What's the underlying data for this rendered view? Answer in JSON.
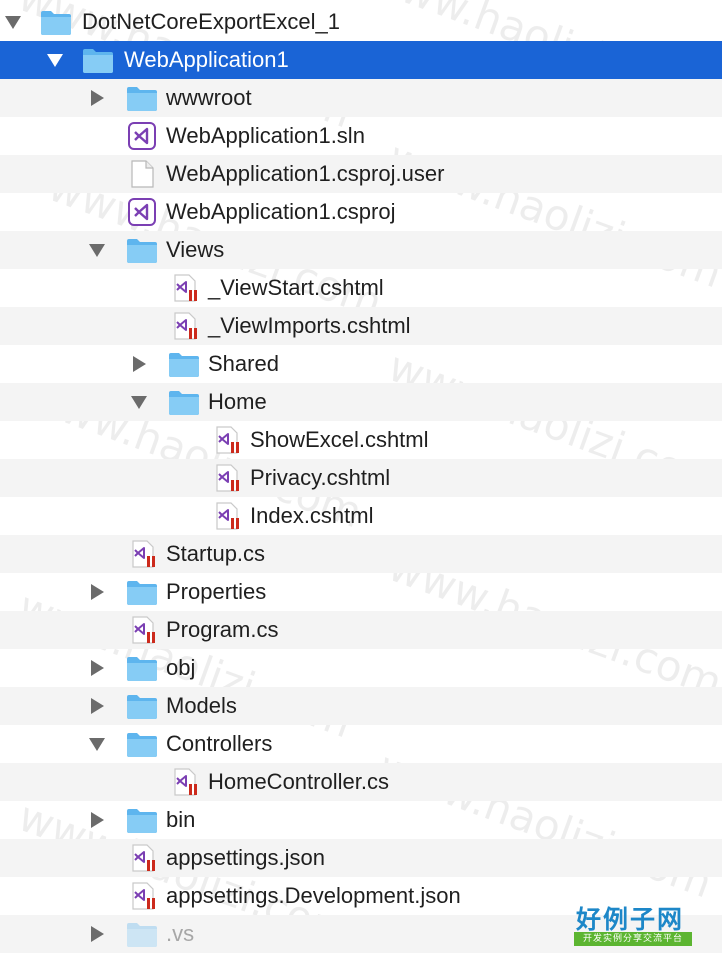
{
  "tree": {
    "rows": [
      {
        "label": "DotNetCoreExportExcel_1",
        "icon": "folder-icon",
        "disclosure": "expanded"
      },
      {
        "label": "WebApplication1",
        "icon": "folder-icon",
        "disclosure": "expanded",
        "selected": true
      },
      {
        "label": "wwwroot",
        "icon": "folder-icon",
        "disclosure": "collapsed"
      },
      {
        "label": "WebApplication1.sln",
        "icon": "visual-studio-icon",
        "disclosure": "none"
      },
      {
        "label": "WebApplication1.csproj.user",
        "icon": "blank-file-icon",
        "disclosure": "none"
      },
      {
        "label": "WebApplication1.csproj",
        "icon": "visual-studio-icon",
        "disclosure": "none"
      },
      {
        "label": "Views",
        "icon": "folder-icon",
        "disclosure": "expanded"
      },
      {
        "label": "_ViewStart.cshtml",
        "icon": "visual-studio-source-file-icon",
        "disclosure": "none"
      },
      {
        "label": "_ViewImports.cshtml",
        "icon": "visual-studio-source-file-icon",
        "disclosure": "none"
      },
      {
        "label": "Shared",
        "icon": "folder-icon",
        "disclosure": "collapsed"
      },
      {
        "label": "Home",
        "icon": "folder-icon",
        "disclosure": "expanded"
      },
      {
        "label": "ShowExcel.cshtml",
        "icon": "visual-studio-source-file-icon",
        "disclosure": "none"
      },
      {
        "label": "Privacy.cshtml",
        "icon": "visual-studio-source-file-icon",
        "disclosure": "none"
      },
      {
        "label": "Index.cshtml",
        "icon": "visual-studio-source-file-icon",
        "disclosure": "none"
      },
      {
        "label": "Startup.cs",
        "icon": "visual-studio-source-file-icon",
        "disclosure": "none"
      },
      {
        "label": "Properties",
        "icon": "folder-icon",
        "disclosure": "collapsed"
      },
      {
        "label": "Program.cs",
        "icon": "visual-studio-source-file-icon",
        "disclosure": "none"
      },
      {
        "label": "obj",
        "icon": "folder-icon",
        "disclosure": "collapsed"
      },
      {
        "label": "Models",
        "icon": "folder-icon",
        "disclosure": "collapsed"
      },
      {
        "label": "Controllers",
        "icon": "folder-icon",
        "disclosure": "expanded"
      },
      {
        "label": "HomeController.cs",
        "icon": "visual-studio-source-file-icon",
        "disclosure": "none"
      },
      {
        "label": "bin",
        "icon": "folder-icon",
        "disclosure": "collapsed"
      },
      {
        "label": "appsettings.json",
        "icon": "visual-studio-source-file-icon",
        "disclosure": "none"
      },
      {
        "label": "appsettings.Development.json",
        "icon": "visual-studio-source-file-icon",
        "disclosure": "none"
      },
      {
        "label": ".vs",
        "icon": "folder-icon",
        "disclosure": "collapsed",
        "dimmed": true
      }
    ]
  },
  "watermark": {
    "text": "www.haolizi.com"
  },
  "logo": {
    "title": "好例子网",
    "subtitle": "开发实例分享交流平台"
  },
  "colors": {
    "selection": "#1a64d6",
    "folder": "#7cc3f1",
    "vs_purple": "#7b3fb3",
    "source_red": "#cc2a1c"
  }
}
